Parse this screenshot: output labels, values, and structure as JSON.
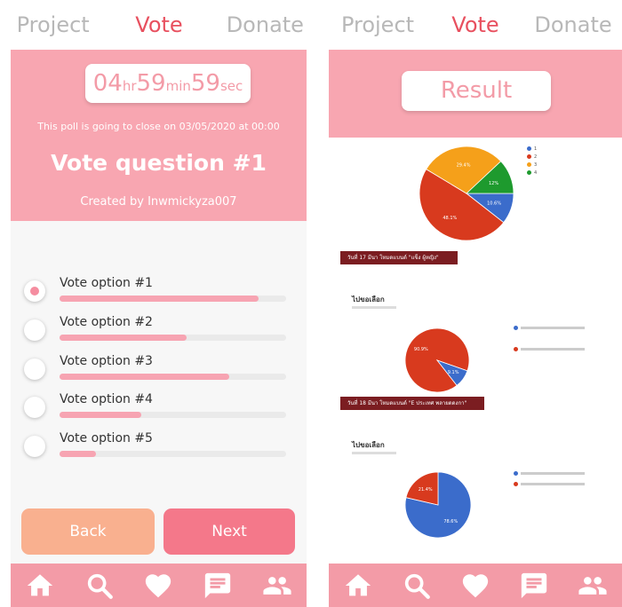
{
  "left": {
    "tabs": [
      "Project",
      "Vote",
      "Donate"
    ],
    "active_tab": 1,
    "timer": {
      "hours": "04",
      "hr_unit": "hr",
      "minutes": "59",
      "min_unit": "min",
      "seconds": "59",
      "sec_unit": "sec"
    },
    "closing_text": "This poll is going to close on 03/05/2020 at 00:00",
    "question": "Vote question #1",
    "creator": "Created by Inwmickyza007",
    "options": [
      {
        "label": "Vote option #1",
        "fraction": 0.88,
        "selected": true
      },
      {
        "label": "Vote option #2",
        "fraction": 0.56,
        "selected": false
      },
      {
        "label": "Vote option #3",
        "fraction": 0.75,
        "selected": false
      },
      {
        "label": "Vote option #4",
        "fraction": 0.36,
        "selected": false
      },
      {
        "label": "Vote option #5",
        "fraction": 0.16,
        "selected": false
      }
    ],
    "back_label": "Back",
    "next_label": "Next",
    "nav_icons": [
      "home-icon",
      "search-icon",
      "heart-icon",
      "chat-icon",
      "people-icon"
    ]
  },
  "right": {
    "tabs": [
      "Project",
      "Vote",
      "Donate"
    ],
    "active_tab": 1,
    "result_label": "Result",
    "nav_icons": [
      "home-icon",
      "search-icon",
      "heart-icon",
      "chat-icon",
      "people-icon"
    ]
  },
  "chart_data": [
    {
      "type": "pie",
      "categories": [
        "1",
        "2",
        "3",
        "4"
      ],
      "values": [
        10.6,
        48.1,
        29.4,
        12
      ],
      "slice_labels": [
        "10.6%",
        "48.1%",
        "29.4%",
        "12%"
      ],
      "colors": [
        "#3b6ccb",
        "#d83a1e",
        "#f5a01a",
        "#1e9a2e"
      ],
      "banner": "วันที่ 17 มีนา โหมดแบนด์ \"แข็ง ผู้หญิง\""
    },
    {
      "type": "pie",
      "title": "ไปขอเลือก",
      "values": [
        90.9,
        9.1
      ],
      "slice_labels": [
        "90.9%",
        "9.1%"
      ],
      "colors": [
        "#d83a1e",
        "#3b6ccb"
      ],
      "banner": "วันที่ 18 มีนา โหมดแบนด์ \"E ประเทศ พลายดดงกา\""
    },
    {
      "type": "pie",
      "title": "ไปขอเลือก",
      "values": [
        78.6,
        21.4
      ],
      "slice_labels": [
        "78.6%",
        "21.4%"
      ],
      "colors": [
        "#3b6ccb",
        "#d83a1e"
      ]
    }
  ]
}
